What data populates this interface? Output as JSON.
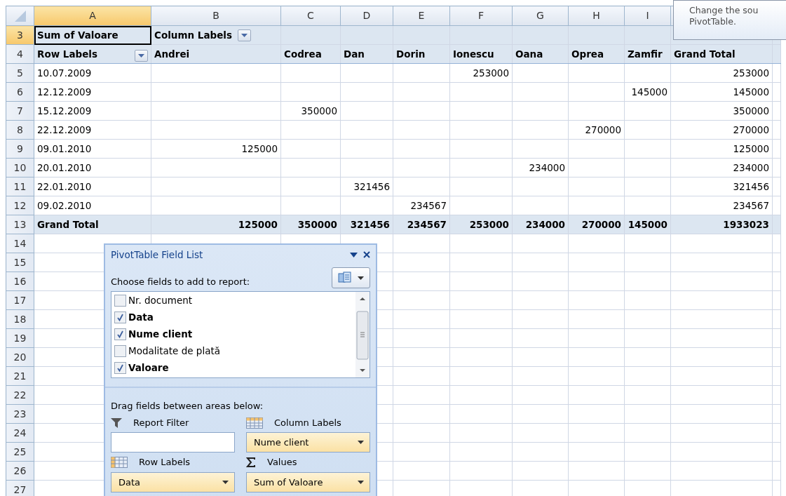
{
  "column_headers": [
    {
      "label": "A",
      "selected": true
    },
    {
      "label": "B",
      "selected": false
    },
    {
      "label": "C",
      "selected": false
    },
    {
      "label": "D",
      "selected": false
    },
    {
      "label": "E",
      "selected": false
    },
    {
      "label": "F",
      "selected": false
    },
    {
      "label": "G",
      "selected": false
    },
    {
      "label": "H",
      "selected": false
    },
    {
      "label": "I",
      "selected": false
    }
  ],
  "row_numbers": [
    {
      "label": "3",
      "selected": true
    },
    {
      "label": "4",
      "selected": false
    },
    {
      "label": "5",
      "selected": false
    },
    {
      "label": "6",
      "selected": false
    },
    {
      "label": "7",
      "selected": false
    },
    {
      "label": "8",
      "selected": false
    },
    {
      "label": "9",
      "selected": false
    },
    {
      "label": "10",
      "selected": false
    },
    {
      "label": "11",
      "selected": false
    },
    {
      "label": "12",
      "selected": false
    },
    {
      "label": "13",
      "selected": false
    },
    {
      "label": "14",
      "selected": false
    },
    {
      "label": "15",
      "selected": false
    },
    {
      "label": "16",
      "selected": false
    },
    {
      "label": "17",
      "selected": false
    },
    {
      "label": "18",
      "selected": false
    },
    {
      "label": "19",
      "selected": false
    },
    {
      "label": "20",
      "selected": false
    },
    {
      "label": "21",
      "selected": false
    },
    {
      "label": "22",
      "selected": false
    },
    {
      "label": "23",
      "selected": false
    },
    {
      "label": "24",
      "selected": false
    },
    {
      "label": "25",
      "selected": false
    },
    {
      "label": "26",
      "selected": false
    },
    {
      "label": "27",
      "selected": false
    }
  ],
  "pivot": {
    "value_label": {
      "text": "Sum of Valoare",
      "selected": true
    },
    "column_labels_label": "Column Labels",
    "row_labels_label": "Row Labels",
    "columns": [
      "Andrei",
      "Codrea",
      "Dan",
      "Dorin",
      "Ionescu",
      "Oana",
      "Oprea",
      "Zamfir",
      "Grand Total"
    ],
    "rows": [
      {
        "label": "10.07.2009",
        "cells": [
          null,
          null,
          null,
          null,
          "253000",
          null,
          null,
          null,
          "253000"
        ]
      },
      {
        "label": "12.12.2009",
        "cells": [
          null,
          null,
          null,
          null,
          null,
          null,
          null,
          "145000",
          "145000"
        ]
      },
      {
        "label": "15.12.2009",
        "cells": [
          null,
          "350000",
          null,
          null,
          null,
          null,
          null,
          null,
          "350000"
        ]
      },
      {
        "label": "22.12.2009",
        "cells": [
          null,
          null,
          null,
          null,
          null,
          null,
          "270000",
          null,
          "270000"
        ]
      },
      {
        "label": "09.01.2010",
        "cells": [
          "125000",
          null,
          null,
          null,
          null,
          null,
          null,
          null,
          "125000"
        ]
      },
      {
        "label": "20.01.2010",
        "cells": [
          null,
          null,
          null,
          null,
          null,
          "234000",
          null,
          null,
          "234000"
        ]
      },
      {
        "label": "22.01.2010",
        "cells": [
          null,
          null,
          "321456",
          null,
          null,
          null,
          null,
          null,
          "321456"
        ]
      },
      {
        "label": "09.02.2010",
        "cells": [
          null,
          null,
          null,
          "234567",
          null,
          null,
          null,
          null,
          "234567"
        ]
      }
    ],
    "grand_total": {
      "label": "Grand Total",
      "cells": [
        "125000",
        "350000",
        "321456",
        "234567",
        "253000",
        "234000",
        "270000",
        "145000",
        "1933023"
      ]
    }
  },
  "tooltip": {
    "lines": [
      "Change the sou",
      "PivotTable."
    ]
  },
  "field_list": {
    "title": "PivotTable Field List",
    "choose_label": "Choose fields to add to report:",
    "fields": [
      {
        "label": "Nr. document",
        "checked": false
      },
      {
        "label": "Data",
        "checked": true
      },
      {
        "label": "Nume client",
        "checked": true
      },
      {
        "label": "Modalitate de plată",
        "checked": false
      },
      {
        "label": "Valoare",
        "checked": true
      }
    ],
    "drag_label": "Drag fields between areas below:",
    "areas": [
      {
        "kind": "filter",
        "label": "Report Filter"
      },
      {
        "kind": "columns",
        "label": "Column Labels",
        "field": "Nume client"
      },
      {
        "kind": "rows",
        "label": "Row Labels",
        "field": "Data"
      },
      {
        "kind": "values",
        "label": "Values",
        "field": "Sum of Valoare"
      }
    ]
  }
}
